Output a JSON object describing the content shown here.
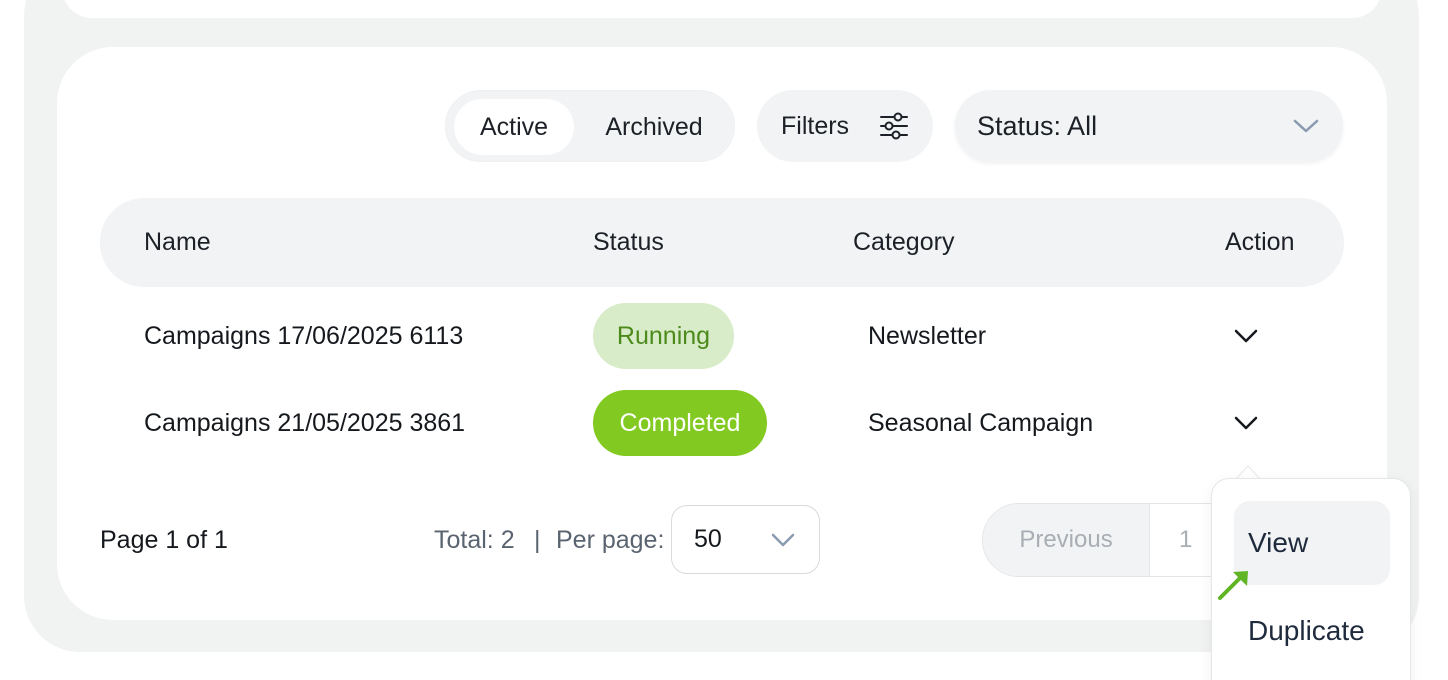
{
  "tabs": [
    {
      "label": "Active",
      "selected": true
    },
    {
      "label": "Archived",
      "selected": false
    }
  ],
  "filters": {
    "label": "Filters",
    "icon": "sliders-icon"
  },
  "status_filter": {
    "label": "Status: All",
    "icon": "chevron-down-icon"
  },
  "table": {
    "columns": [
      "Name",
      "Status",
      "Category",
      "Action"
    ],
    "rows": [
      {
        "name": "Campaigns 17/06/2025 6113",
        "status": "Running",
        "category": "Newsletter"
      },
      {
        "name": "Campaigns 21/05/2025 3861",
        "status": "Completed",
        "category": "Seasonal Campaign"
      }
    ]
  },
  "footer": {
    "page_info": "Page 1 of 1",
    "total": "Total: 2",
    "separator": "|",
    "per_page_label": "Per page:",
    "per_page_value": "50",
    "previous_label": "Previous",
    "current_page": "1"
  },
  "action_menu": {
    "items": [
      "View",
      "Duplicate"
    ]
  },
  "colors": {
    "running_bg": "#d8ecc9",
    "running_text": "#4c8a1b",
    "completed_bg": "#82ca21",
    "completed_text": "#ffffff",
    "cursor": "#5fb523"
  }
}
